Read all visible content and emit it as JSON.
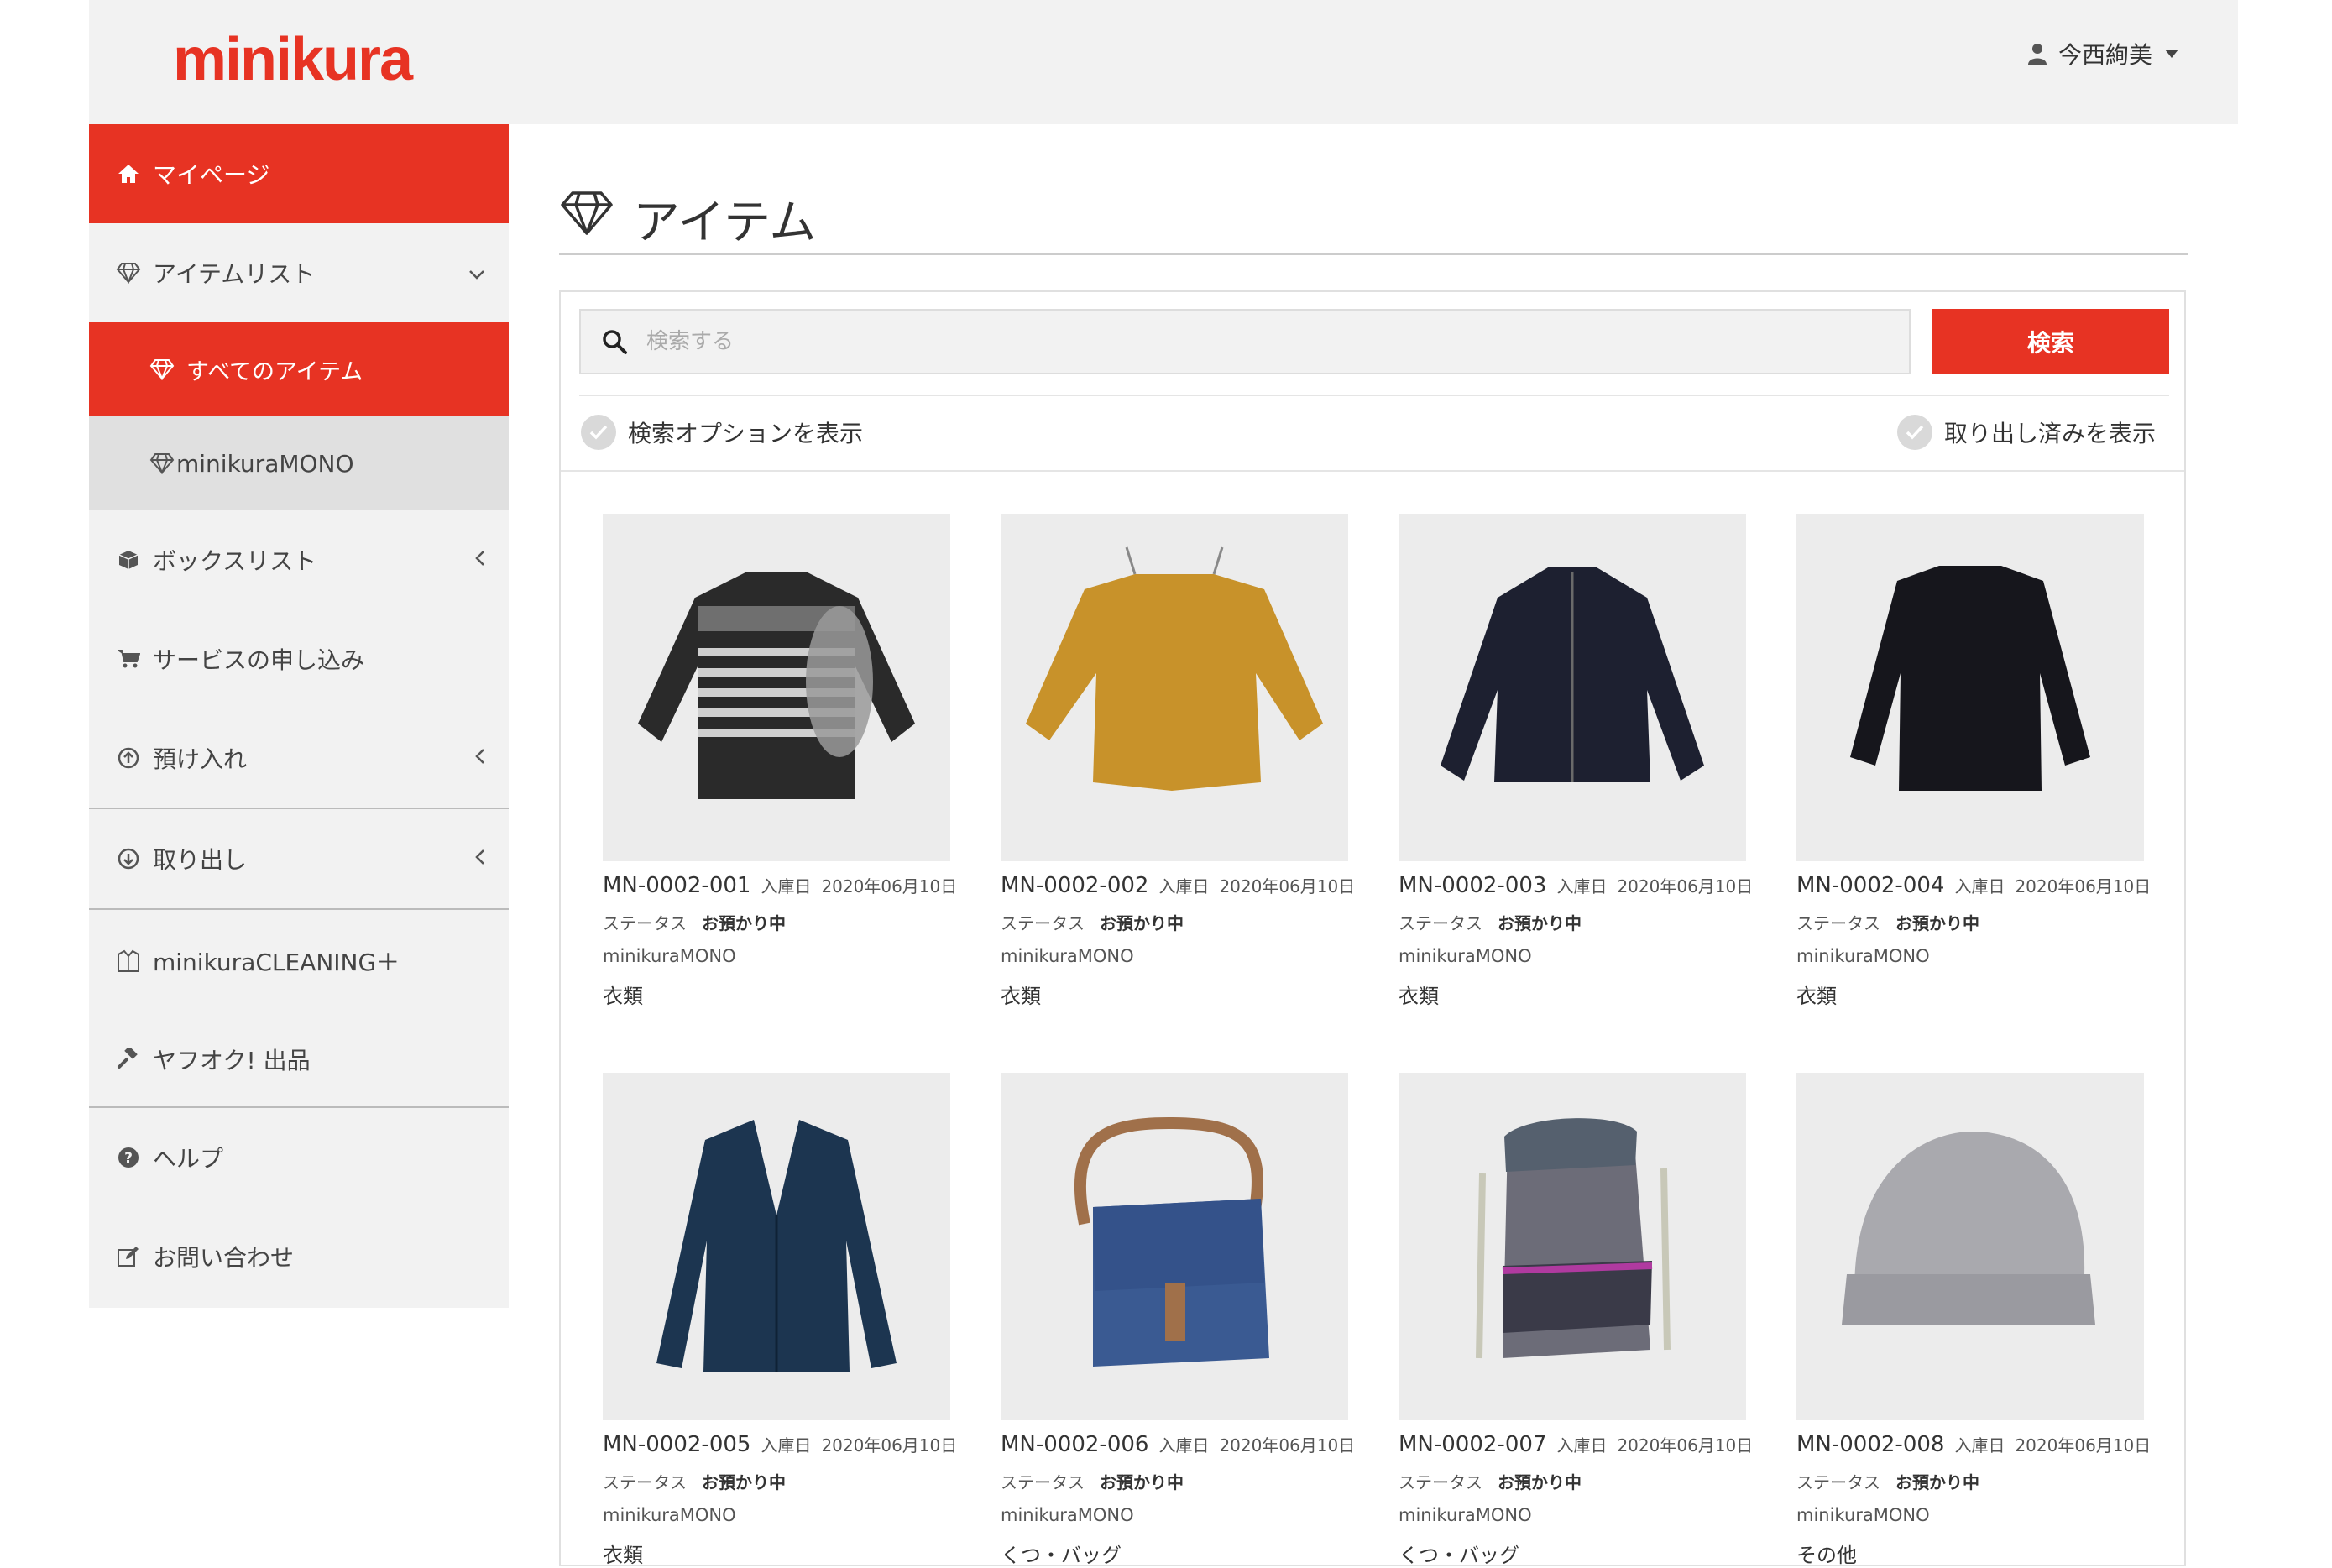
{
  "header": {
    "logo": "minikura",
    "user_name": "今西絢美"
  },
  "sidebar": {
    "mypage": "マイページ",
    "itemlist": "アイテムリスト",
    "all_items": "すべてのアイテム",
    "minikura_mono": "minikuraMONO",
    "boxlist": "ボックスリスト",
    "service_apply": "サービスの申し込み",
    "deposit": "預け入れ",
    "retrieve": "取り出し",
    "cleaning": "minikuraCLEANING＋",
    "yahuoku": "ヤフオク! 出品",
    "help": "ヘルプ",
    "contact": "お問い合わせ"
  },
  "main": {
    "title": "アイテム",
    "search": {
      "placeholder": "検索する",
      "button": "検索"
    },
    "options": {
      "show_options": "検索オプションを表示",
      "show_retrieved": "取り出し済みを表示"
    }
  },
  "items": [
    {
      "code": "MN-0002-001",
      "date_label": "入庫日",
      "date": "2020年06月10日",
      "status_label": "ステータス",
      "status": "お預かり中",
      "service": "minikuraMONO",
      "category": "衣類"
    },
    {
      "code": "MN-0002-002",
      "date_label": "入庫日",
      "date": "2020年06月10日",
      "status_label": "ステータス",
      "status": "お預かり中",
      "service": "minikuraMONO",
      "category": "衣類"
    },
    {
      "code": "MN-0002-003",
      "date_label": "入庫日",
      "date": "2020年06月10日",
      "status_label": "ステータス",
      "status": "お預かり中",
      "service": "minikuraMONO",
      "category": "衣類"
    },
    {
      "code": "MN-0002-004",
      "date_label": "入庫日",
      "date": "2020年06月10日",
      "status_label": "ステータス",
      "status": "お預かり中",
      "service": "minikuraMONO",
      "category": "衣類"
    },
    {
      "code": "MN-0002-005",
      "date_label": "入庫日",
      "date": "2020年06月10日",
      "status_label": "ステータス",
      "status": "お預かり中",
      "service": "minikuraMONO",
      "category": "衣類"
    },
    {
      "code": "MN-0002-006",
      "date_label": "入庫日",
      "date": "2020年06月10日",
      "status_label": "ステータス",
      "status": "お預かり中",
      "service": "minikuraMONO",
      "category": "くつ・バッグ"
    },
    {
      "code": "MN-0002-007",
      "date_label": "入庫日",
      "date": "2020年06月10日",
      "status_label": "ステータス",
      "status": "お預かり中",
      "service": "minikuraMONO",
      "category": "くつ・バッグ"
    },
    {
      "code": "MN-0002-008",
      "date_label": "入庫日",
      "date": "2020年06月10日",
      "status_label": "ステータス",
      "status": "お預かり中",
      "service": "minikuraMONO",
      "category": "その他"
    }
  ],
  "item_icons": [
    "patterned-sweater",
    "mustard-sweater",
    "navy-zip-jacket",
    "black-sweater",
    "navy-cardigan",
    "blue-messenger-bag",
    "lecoq-backpack",
    "knit-hat"
  ],
  "colors": {
    "brand": "#e73323",
    "header_bg": "#f2f2f2",
    "sidebar_bg": "#f2f2f2",
    "submenu_bg": "#e0e0e0"
  }
}
